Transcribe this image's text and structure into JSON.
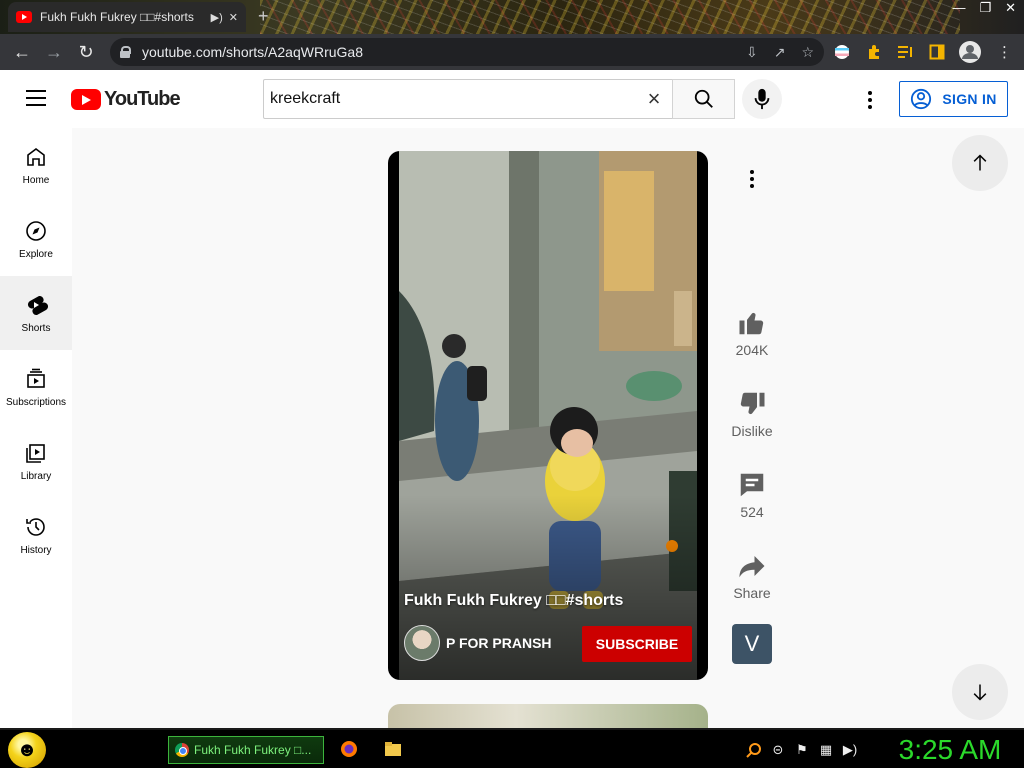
{
  "browser": {
    "tab_title": "Fukh Fukh Fukrey □□#shorts",
    "url": "youtube.com/shorts/A2aqWRruGa8"
  },
  "header": {
    "logo_text": "YouTube",
    "search_value": "kreekcraft",
    "signin_label": "SIGN IN"
  },
  "sidebar": {
    "items": [
      {
        "label": "Home",
        "icon": "home-icon"
      },
      {
        "label": "Explore",
        "icon": "compass-icon"
      },
      {
        "label": "Shorts",
        "icon": "shorts-icon"
      },
      {
        "label": "Subscriptions",
        "icon": "subscriptions-icon"
      },
      {
        "label": "Library",
        "icon": "library-icon"
      },
      {
        "label": "History",
        "icon": "history-icon"
      }
    ]
  },
  "short": {
    "title": "Fukh Fukh Fukrey □□#shorts",
    "channel": "P FOR PRANSH",
    "subscribe_label": "SUBSCRIBE"
  },
  "actions": {
    "likes": "204K",
    "dislike_label": "Dislike",
    "comments": "524",
    "share_label": "Share",
    "channel_initial": "V"
  },
  "taskbar": {
    "task_label": "Fukh Fukh Fukrey □...",
    "clock": "3:25 AM"
  },
  "colors": {
    "brand_red": "#ff0000",
    "subscribe_red": "#cc0000",
    "signin_blue": "#065fd4",
    "clock_green": "#2bd92b"
  }
}
